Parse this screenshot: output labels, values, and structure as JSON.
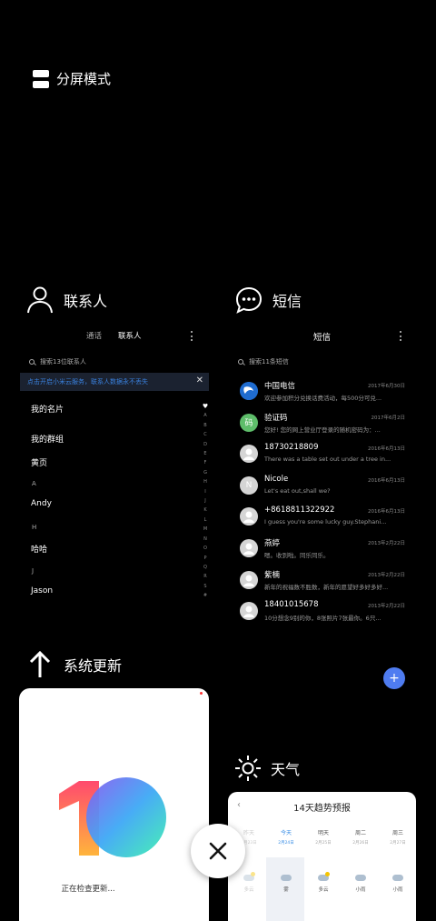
{
  "split_mode": {
    "label": "分屏模式"
  },
  "contacts_app": {
    "title": "联系人",
    "tabs": [
      "通话",
      "联系人"
    ],
    "search_placeholder": "搜索13位联系人",
    "banner_text": "点击开启小米云服务，联系人数据永不丢失",
    "items": [
      {
        "type": "item",
        "text": "我的名片"
      },
      {
        "type": "item",
        "text": "我的群组"
      },
      {
        "type": "item",
        "text": "黄页"
      },
      {
        "type": "letter",
        "text": "A"
      },
      {
        "type": "item",
        "text": "Andy"
      },
      {
        "type": "letter",
        "text": "H"
      },
      {
        "type": "item",
        "text": "哈哈"
      },
      {
        "type": "letter",
        "text": "J"
      },
      {
        "type": "item",
        "text": "Jason"
      }
    ],
    "index_letters": [
      "♥",
      "A",
      "B",
      "C",
      "D",
      "E",
      "F",
      "G",
      "H",
      "I",
      "J",
      "K",
      "L",
      "M",
      "N",
      "O",
      "P",
      "Q",
      "R",
      "S",
      "#"
    ]
  },
  "sms_app": {
    "title": "短信",
    "header": "短信",
    "search_placeholder": "搜索11条短信",
    "messages": [
      {
        "name": "中国电信",
        "date": "2017年6月30日",
        "preview": "欢迎参加积分兑换话费活动，每500分可兑...",
        "avatar": "telecom"
      },
      {
        "name": "验证码",
        "date": "2017年6月2日",
        "preview": "您好! 您的网上营业厅登录的随机密码为：...",
        "avatar": "code"
      },
      {
        "name": "18730218809",
        "date": "2016年6月13日",
        "preview": "There was a table set out under a tree in...",
        "avatar": "default"
      },
      {
        "name": "Nicole",
        "date": "2016年6月13日",
        "preview": "Let's eat out,shall we?",
        "avatar": "N"
      },
      {
        "name": "+8618811322922",
        "date": "2016年6月13日",
        "preview": "I guess you're some lucky guy.Stephani...",
        "avatar": "default"
      },
      {
        "name": "燕婷",
        "date": "2013年2月22日",
        "preview": "嗯。收到啦。同乐同乐。",
        "avatar": "default"
      },
      {
        "name": "紫楠",
        "date": "2013年2月22日",
        "preview": "新年的祝福数不胜数，新年的愿望好多好多好...",
        "avatar": "default"
      },
      {
        "name": "18401015678",
        "date": "2013年2月22日",
        "preview": "10分想念9别的你，8张照片7张最你。6只...",
        "avatar": "default"
      }
    ],
    "compose_label": "+"
  },
  "update_app": {
    "title": "系统更新",
    "status": "正在检查更新..."
  },
  "weather_app": {
    "title": "天气",
    "card_title": "14天趋势预报",
    "days": [
      {
        "day": "昨天",
        "date": "2月23日",
        "cond": "多云",
        "style": "faded",
        "icon": "sunny"
      },
      {
        "day": "今天",
        "date": "2月24日",
        "cond": "雾",
        "style": "today",
        "icon": "cloud"
      },
      {
        "day": "明天",
        "date": "2月25日",
        "cond": "多云",
        "style": "",
        "icon": "sunny"
      },
      {
        "day": "周二",
        "date": "2月26日",
        "cond": "小雨",
        "style": "",
        "icon": "cloud"
      },
      {
        "day": "周三",
        "date": "2月27日",
        "cond": "小雨",
        "style": "",
        "icon": "cloud"
      }
    ]
  },
  "colors": {
    "accent_blue": "#4f7cf0",
    "banner_link": "#3a82e0"
  }
}
